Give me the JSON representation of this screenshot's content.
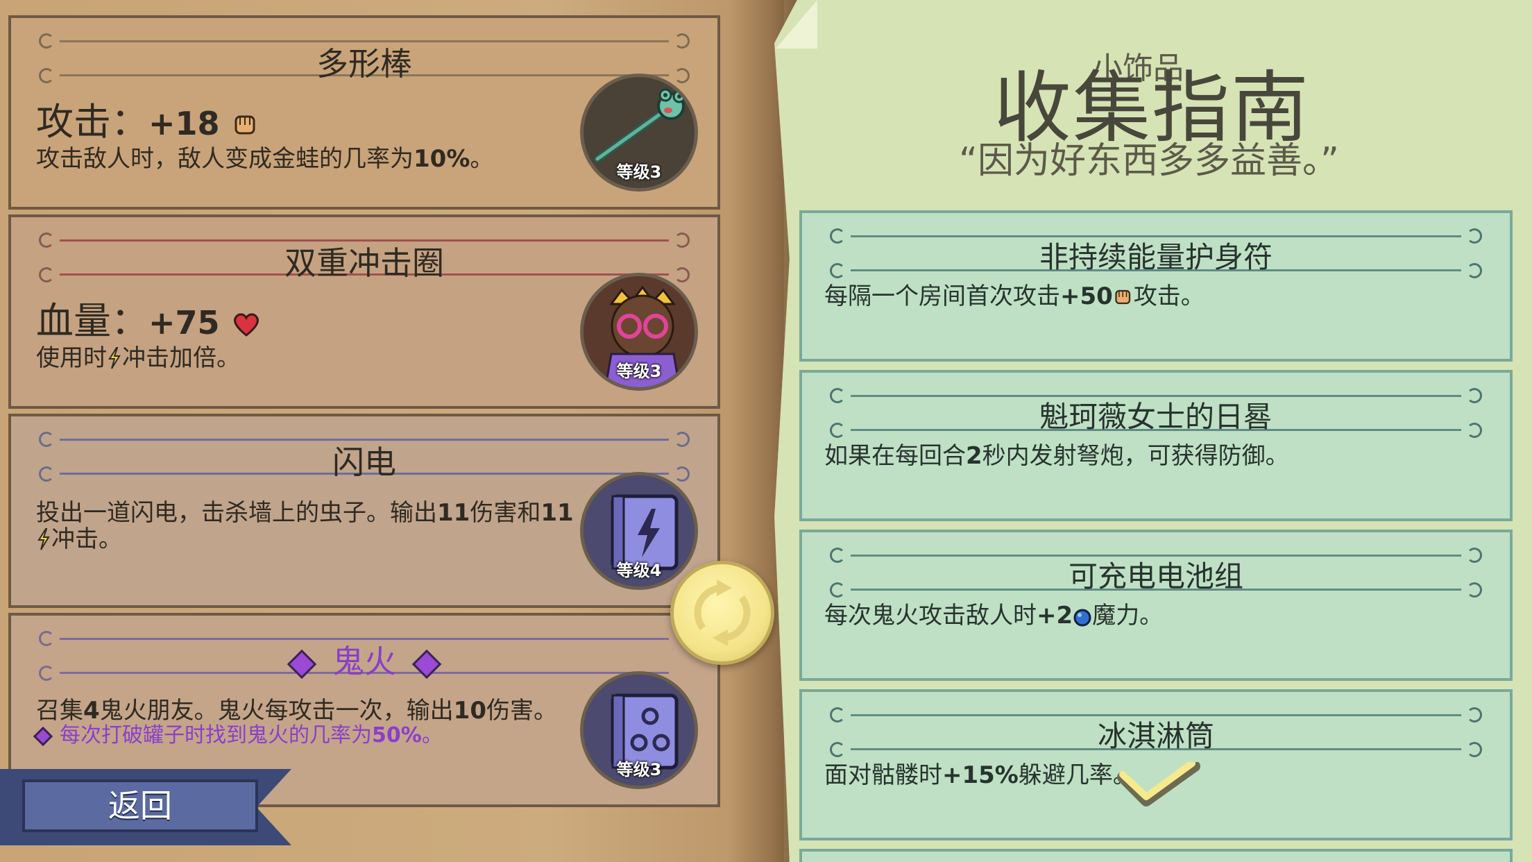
{
  "left_items": [
    {
      "name": "多形棒",
      "stat_label": "攻击：",
      "stat_value": "+18",
      "stat_icon": "fist-icon",
      "desc_pre": "攻击敌人时，敌人变成金蛙的几率为",
      "desc_bold": "10%",
      "desc_post": "。",
      "level": "等级3",
      "badge_icon": "frog-wand-icon"
    },
    {
      "name": "双重冲击圈",
      "stat_label": "血量：",
      "stat_value": "+75",
      "stat_icon": "heart-icon",
      "desc_pre": "使用时",
      "desc_icon": "lightning-icon",
      "desc_post": "冲击加倍。",
      "level": "等级3",
      "badge_icon": "character-portrait-icon"
    },
    {
      "name": "闪电",
      "desc_line1_pre": "投出一道闪电，击杀墙上的虫子。输出",
      "desc_line1_b1": "11",
      "desc_line1_mid": "伤害和",
      "desc_line1_b2": "11",
      "desc_line2": "冲击。",
      "level": "等级4",
      "badge_icon": "lightning-book-icon"
    },
    {
      "name": "鬼火",
      "desc_pre": "召集",
      "desc_b1": "4",
      "desc_mid": "鬼火朋友。鬼火每攻击一次，输出",
      "desc_b2": "10",
      "desc_post": "伤害。",
      "bonus_pre": "每次打破罐子时找到鬼火的几率为",
      "bonus_bold": "50%",
      "bonus_post": "。",
      "level": "等级3",
      "badge_icon": "wisp-book-icon"
    }
  ],
  "back_button": "返回",
  "guide": {
    "small_title": "小饰品",
    "title": "收集指南",
    "quote": "“因为好东西多多益善。”"
  },
  "guide_items": [
    {
      "name": "非持续能量护身符",
      "desc_pre": "每隔一个房间首次攻击",
      "desc_bold": "+50",
      "desc_icon": "fist-icon",
      "desc_post": "攻击。"
    },
    {
      "name": "魁珂薇女士的日晷",
      "desc_pre": "如果在每回合",
      "desc_bold": "2",
      "desc_post": "秒内发射弩炮，可获得防御。"
    },
    {
      "name": "可充电电池组",
      "desc_pre": "每次鬼火攻击敌人时",
      "desc_bold": "+2",
      "desc_icon": "mana-orb-icon",
      "desc_post": "魔力。"
    },
    {
      "name": "冰淇淋筒",
      "desc_pre": "面对骷髅时",
      "desc_bold": "+15%",
      "desc_post": "躲避几率。"
    }
  ],
  "colors": {
    "left_page": "#c9a67a",
    "right_page": "#d6e3b4",
    "guide_card": "#bfe0c4",
    "accent_purple": "#8a3fc9",
    "back_button": "#5b6aa0"
  }
}
